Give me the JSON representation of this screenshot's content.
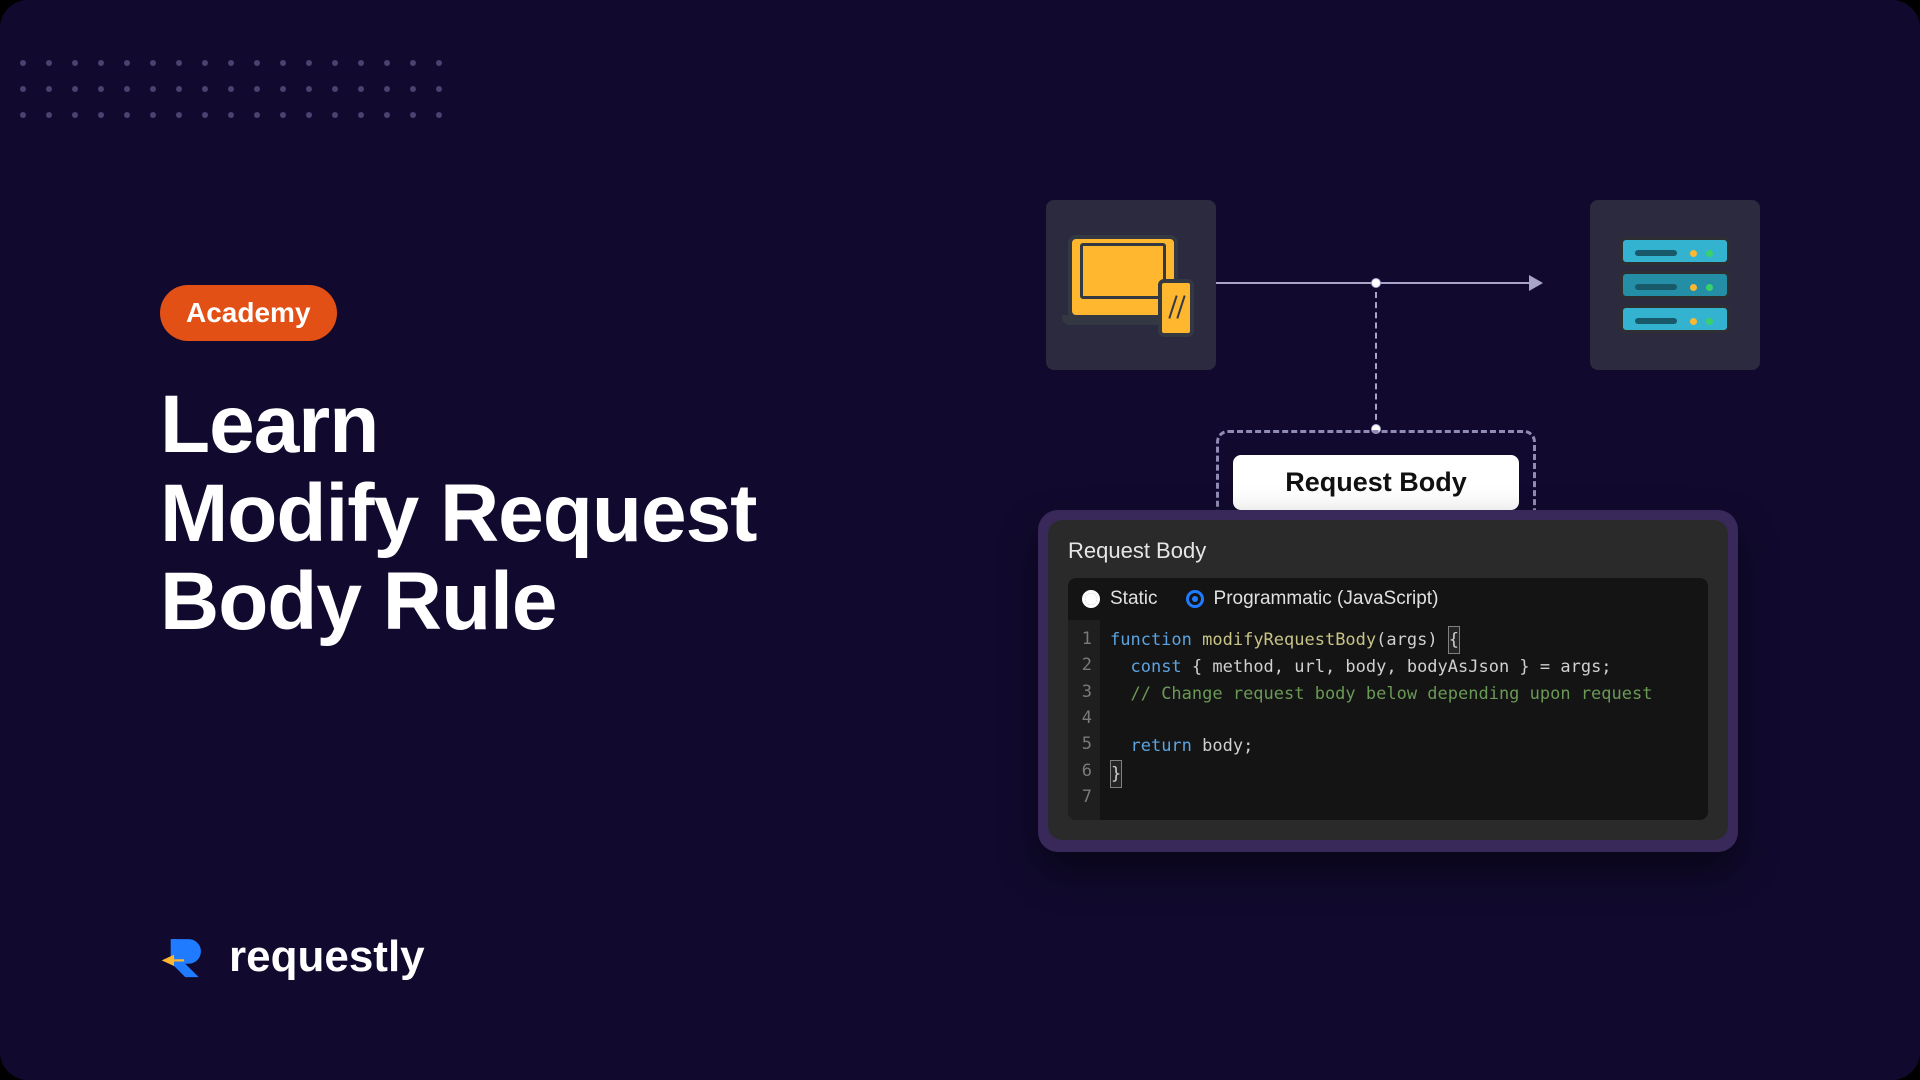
{
  "badge": "Academy",
  "title": {
    "line1": "Learn",
    "line2": "Modify Request",
    "line3": "Body Rule"
  },
  "brand": "requestly",
  "interceptLabel": "Request Body",
  "panel": {
    "title": "Request Body",
    "tabs": {
      "static": "Static",
      "programmatic": "Programmatic (JavaScript)"
    },
    "selected": "programmatic"
  },
  "code": {
    "lines": [
      "1",
      "2",
      "3",
      "4",
      "5",
      "6",
      "7"
    ],
    "kw_function": "function",
    "fn_name": "modifyRequestBody",
    "args_sig": "(args) ",
    "brace_open": "{",
    "kw_const": "const",
    "destruct": " { method, url, body, bodyAsJson } = args;",
    "comment": "// Change request body below depending upon request",
    "kw_return": "return",
    "ret_tail": " body;",
    "brace_close": "}"
  }
}
